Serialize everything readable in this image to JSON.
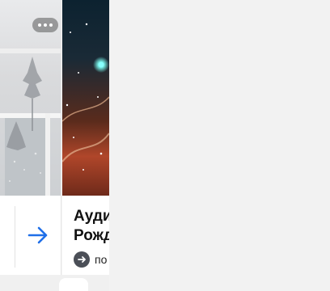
{
  "cards": [
    {
      "more_icon": "more-horizontal-icon",
      "nav_icon": "arrow-right-icon",
      "accent": "#1f6fe8"
    },
    {
      "title_line1": "Ауди",
      "title_line2": "Рожд",
      "meta_text": "по",
      "meta_icon": "arrow-circle-icon"
    }
  ]
}
